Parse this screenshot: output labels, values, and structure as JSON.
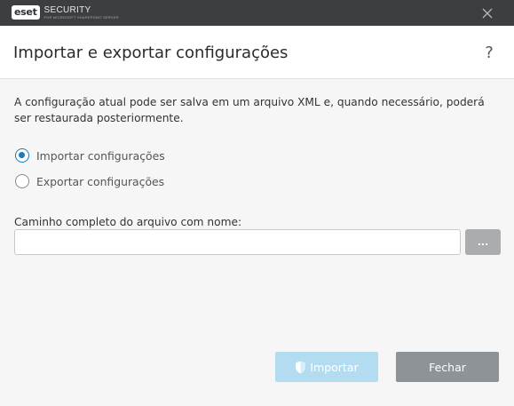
{
  "titlebar": {
    "logo_badge": "eset",
    "logo_main": "SECURITY",
    "logo_sub": "FOR MICROSOFT SHAREPOINT SERVER"
  },
  "header": {
    "title": "Importar e exportar configurações",
    "help_label": "?"
  },
  "body": {
    "description": "A configuração atual pode ser salva em um arquivo XML e, quando necessário, poderá ser restaurada posteriormente.",
    "options": [
      {
        "label": "Importar configurações",
        "selected": true
      },
      {
        "label": "Exportar configurações",
        "selected": false
      }
    ],
    "path_label": "Caminho completo do arquivo com nome:",
    "path_value": "",
    "browse_label": "..."
  },
  "footer": {
    "import_label": "Importar",
    "close_label": "Fechar"
  },
  "colors": {
    "titlebar": "#3b3f42",
    "accent": "#1c7bb8",
    "import_button_disabled": "#b4dcf1",
    "close_button": "#8e9397",
    "browse_button": "#a9adb0"
  },
  "icons": [
    "close-icon",
    "help-icon",
    "shield-icon"
  ]
}
